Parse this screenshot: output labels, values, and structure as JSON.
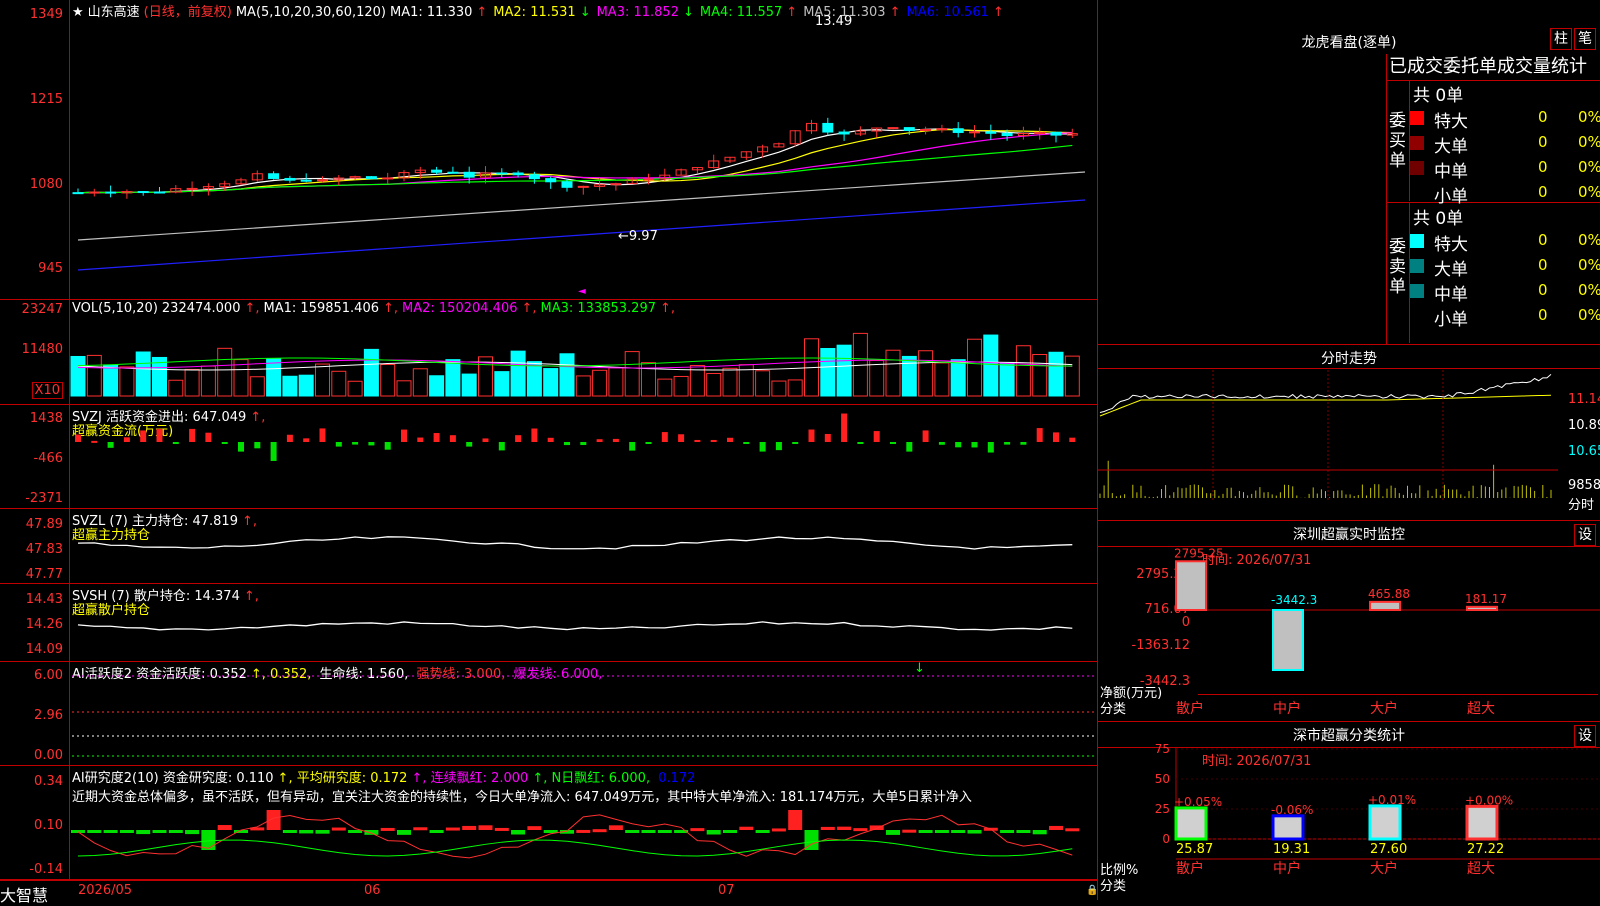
{
  "main": {
    "title": "山东高速",
    "period": "(日线，前复权)",
    "ma_label": "MA(5,10,20,30,60,120)",
    "ma": [
      {
        "label": "MA1: 11.330",
        "arrow": "↑",
        "color": "#ffffff"
      },
      {
        "label": "MA2: 11.531",
        "arrow": "↓",
        "color": "#ffff00"
      },
      {
        "label": "MA3: 11.852",
        "arrow": "↓",
        "color": "#ff00ff"
      },
      {
        "label": "MA4: 11.557",
        "arrow": "↑",
        "color": "#00ff00"
      },
      {
        "label": "MA5: 11.303",
        "arrow": "↑",
        "color": "#c0c0c0"
      },
      {
        "label": "MA6: 10.561",
        "arrow": "↑",
        "color": "#0000ff"
      }
    ],
    "y_labels": [
      "1349",
      "1215",
      "1080",
      "945"
    ],
    "high_label": "13.49",
    "low_label": "←9.97",
    "bottom_right_mark": "◄"
  },
  "vol": {
    "header": "VOL(5,10,20)",
    "value": "232474.000",
    "ma": [
      {
        "label": "MA1: 159851.406",
        "color": "#ffffff"
      },
      {
        "label": "MA2: 150204.406",
        "color": "#ff00ff"
      },
      {
        "label": "MA3: 133853.297",
        "color": "#00ff00"
      }
    ],
    "y_labels": [
      "23247",
      "11480"
    ],
    "unit": "X10"
  },
  "svzj": {
    "header": "SVZJ  活跃资金进出: 647.049",
    "sub": "超赢资金流(万元)",
    "y_labels": [
      "1438",
      "-466",
      "-2371"
    ]
  },
  "svzl": {
    "header": "SVZL (7) 主力持仓: 47.819",
    "sub": "超赢主力持仓",
    "y_labels": [
      "47.89",
      "47.83",
      "47.77"
    ]
  },
  "svsh": {
    "header": "SVSH (7) 散户持仓: 14.374",
    "sub": "超赢散户持仓",
    "y_labels": [
      "14.43",
      "14.26",
      "14.09"
    ]
  },
  "ai1": {
    "header_parts": [
      {
        "text": "AI活跃度2 资金活跃度: 0.352",
        "color": "#ffffff"
      },
      {
        "text": "↑, 0.352,",
        "color": "#ffff00"
      },
      {
        "text": " 生命线: 1.560,",
        "color": "#ffffff"
      },
      {
        "text": " 强势线: 3.000,",
        "color": "#ff3030"
      },
      {
        "text": " 爆发线: 6.000,",
        "color": "#ff00ff"
      }
    ],
    "y_labels": [
      "6.00",
      "2.96",
      "0.00"
    ]
  },
  "ai2": {
    "header_parts": [
      {
        "text": "AI研究度2(10) 资金研究度: 0.110",
        "color": "#ffffff"
      },
      {
        "text": "↑, 平均研究度: 0.172",
        "color": "#ffff00"
      },
      {
        "text": "↑, 连续飘红: 2.000",
        "color": "#ff00ff"
      },
      {
        "text": "↑, N日飘红: 6.000,",
        "color": "#00ff00"
      },
      {
        "text": " 0.172",
        "color": "#0000ff"
      }
    ],
    "comment": "近期大资金总体偏多，虽不活跃，但有异动，宜关注大资金的持续性，今日大单净流入: 647.049万元，其中特大单净流入: 181.174万元，大单5日累计净入",
    "y_labels": [
      "0.34",
      "0.10",
      "-0.14"
    ]
  },
  "xaxis": {
    "labels": [
      "2026/05",
      "06",
      "07"
    ],
    "brand": "大智慧"
  },
  "longhu": {
    "title": "龙虎看盘(逐单)",
    "btn1": "柱",
    "btn2": "笔",
    "tabs": "已成交委托单成交量统计",
    "buy": {
      "side": "委买单",
      "total": "共 0单",
      "rows": [
        {
          "name": "特大",
          "count": "0",
          "pct": "0%",
          "color": "#ff0000"
        },
        {
          "name": "大单",
          "count": "0",
          "pct": "0%",
          "color": "#900000"
        },
        {
          "name": "中单",
          "count": "0",
          "pct": "0%",
          "color": "#700000"
        },
        {
          "name": "小单",
          "count": "0",
          "pct": "0%",
          "color": ""
        }
      ]
    },
    "sell": {
      "side": "委卖单",
      "total": "共 0单",
      "rows": [
        {
          "name": "特大",
          "count": "0",
          "pct": "0%",
          "color": "#00ffff"
        },
        {
          "name": "大单",
          "count": "0",
          "pct": "0%",
          "color": "#008080"
        },
        {
          "name": "中单",
          "count": "0",
          "pct": "0%",
          "color": "#008080"
        },
        {
          "name": "小单",
          "count": "0",
          "pct": "0%",
          "color": ""
        }
      ]
    }
  },
  "fenshi": {
    "title": "分时走势",
    "labels": [
      "11.14",
      "10.89",
      "10.65",
      "9858",
      "分时"
    ]
  },
  "sz_monitor": {
    "title": "深圳超赢实时监控",
    "setting": "设",
    "time": "时间: 2026/07/31",
    "y_labels": [
      "2795.25",
      "716.07",
      "0",
      "-1363.12",
      "-3442.3"
    ],
    "side_label": "净额(万元)",
    "side_label2": "分类",
    "categories": [
      "散户",
      "中户",
      "大户",
      "超大"
    ],
    "value_labels": [
      "2795.25",
      "-3442.3",
      "465.88",
      "181.17"
    ]
  },
  "sz_stats": {
    "title": "深市超赢分类统计",
    "setting": "设",
    "time": "时间: 2026/07/31",
    "y_labels": [
      "75",
      "50",
      "25",
      "0"
    ],
    "side_label": "比例%",
    "side_label2": "分类",
    "categories": [
      "散户",
      "中户",
      "大户",
      "超大"
    ],
    "top_labels": [
      "+0.05%",
      "-0.06%",
      "+0.01%",
      "+0.00%"
    ],
    "values": [
      "25.87",
      "19.31",
      "27.60",
      "27.22"
    ]
  },
  "chart_data": {
    "type": "bar",
    "title": "深市超赢分类统计",
    "categories": [
      "散户",
      "中户",
      "大户",
      "超大"
    ],
    "values": [
      25.87,
      19.31,
      27.6,
      27.22
    ],
    "ylabel": "比例%",
    "ylim": [
      0,
      75
    ]
  }
}
